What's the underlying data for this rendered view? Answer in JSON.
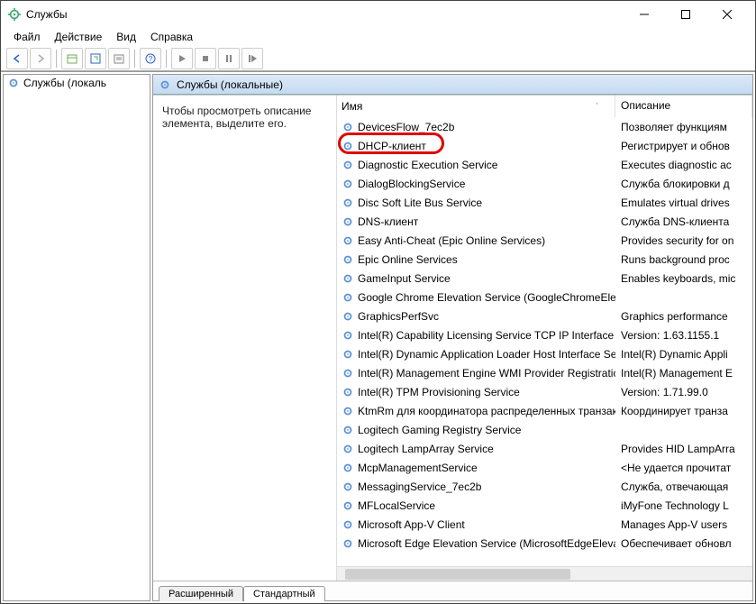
{
  "window": {
    "title": "Службы"
  },
  "menu": {
    "file": "Файл",
    "action": "Действие",
    "view": "Вид",
    "help": "Справка"
  },
  "tree": {
    "root": "Службы (локаль"
  },
  "panel": {
    "title": "Службы (локальные)"
  },
  "detail": {
    "text": "Чтобы просмотреть описание элемента, выделите его."
  },
  "columns": {
    "name": "Имя",
    "description": "Описание"
  },
  "services": [
    {
      "name": "DevicesFlow_7ec2b",
      "desc": "Позволяет функциям"
    },
    {
      "name": "DHCP-клиент",
      "desc": "Регистрирует и обнов"
    },
    {
      "name": "Diagnostic Execution Service",
      "desc": "Executes diagnostic ac"
    },
    {
      "name": "DialogBlockingService",
      "desc": "Служба блокировки д"
    },
    {
      "name": "Disc Soft Lite Bus Service",
      "desc": "Emulates virtual drives"
    },
    {
      "name": "DNS-клиент",
      "desc": "Служба DNS-клиента"
    },
    {
      "name": "Easy Anti-Cheat (Epic Online Services)",
      "desc": "Provides security for on"
    },
    {
      "name": "Epic Online Services",
      "desc": "Runs background proc"
    },
    {
      "name": "GameInput Service",
      "desc": "Enables keyboards, mic"
    },
    {
      "name": "Google Chrome Elevation Service (GoogleChromeElev...",
      "desc": ""
    },
    {
      "name": "GraphicsPerfSvc",
      "desc": "Graphics performance"
    },
    {
      "name": "Intel(R) Capability Licensing Service TCP IP Interface",
      "desc": "Version: 1.63.1155.1"
    },
    {
      "name": "Intel(R) Dynamic Application Loader Host Interface Ser...",
      "desc": "Intel(R) Dynamic Appli"
    },
    {
      "name": "Intel(R) Management Engine WMI Provider Registration",
      "desc": "Intel(R) Management E"
    },
    {
      "name": "Intel(R) TPM Provisioning Service",
      "desc": "Version: 1.71.99.0"
    },
    {
      "name": "KtmRm для координатора распределенных транзак...",
      "desc": "Координирует транза"
    },
    {
      "name": "Logitech Gaming Registry Service",
      "desc": ""
    },
    {
      "name": "Logitech LampArray Service",
      "desc": "Provides HID LampArra"
    },
    {
      "name": "McpManagementService",
      "desc": "<Не удается прочитат"
    },
    {
      "name": "MessagingService_7ec2b",
      "desc": "Служба, отвечающая"
    },
    {
      "name": "MFLocalService",
      "desc": "iMyFone Technology L"
    },
    {
      "name": "Microsoft App-V Client",
      "desc": "Manages App-V users"
    },
    {
      "name": "Microsoft Edge Elevation Service (MicrosoftEdgeElevati...",
      "desc": "Обеспечивает обновл"
    }
  ],
  "tabs": {
    "extended": "Расширенный",
    "standard": "Стандартный"
  }
}
